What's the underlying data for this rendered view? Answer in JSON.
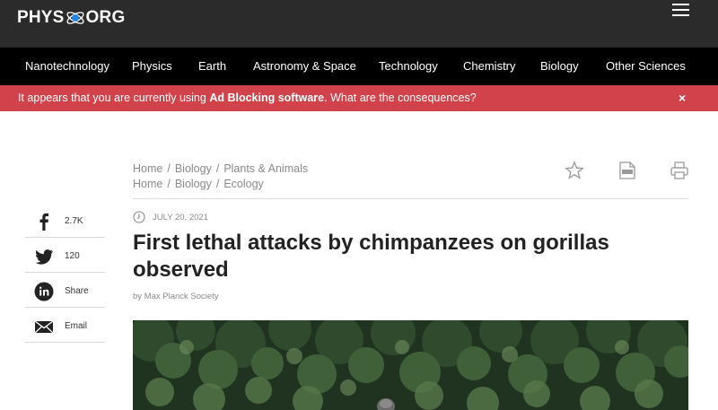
{
  "header": {
    "logo_left": "PHYS",
    "logo_right": "ORG",
    "menu_icon": "hamburger-menu-icon"
  },
  "nav": {
    "items": [
      {
        "label": "Nanotechnology"
      },
      {
        "label": "Physics"
      },
      {
        "label": "Earth"
      },
      {
        "label": "Astronomy & Space"
      },
      {
        "label": "Technology"
      },
      {
        "label": "Chemistry"
      },
      {
        "label": "Biology"
      },
      {
        "label": "Other Sciences"
      }
    ]
  },
  "adblock": {
    "prefix": "It appears that you are currently using",
    "bold": "Ad Blocking software",
    "suffix": ". What are the consequences?",
    "close": "×"
  },
  "breadcrumbs": [
    {
      "home": "Home",
      "section": "Biology",
      "topic": "Plants & Animals"
    },
    {
      "home": "Home",
      "section": "Biology",
      "topic": "Ecology"
    }
  ],
  "breadcrumb_separator": "/",
  "tools": {
    "bookmark_icon": "star-icon",
    "pdf_icon": "pdf-icon",
    "print_icon": "print-icon"
  },
  "article": {
    "date": "JULY 20, 2021",
    "title": "First lethal attacks by chimpanzees on gorillas observed",
    "byline": "by Max Planck Society"
  },
  "share": {
    "facebook": {
      "icon": "facebook-icon",
      "label": "2.7K"
    },
    "twitter": {
      "icon": "twitter-icon",
      "label": "120"
    },
    "linkedin": {
      "icon": "linkedin-icon",
      "label": "Share"
    },
    "email": {
      "icon": "email-icon",
      "label": "Email"
    }
  },
  "colors": {
    "header_bg": "#2b2b2b",
    "nav_bg": "#000000",
    "adbar_bg": "#d1424b",
    "logo_accent": "#1e88e5"
  }
}
